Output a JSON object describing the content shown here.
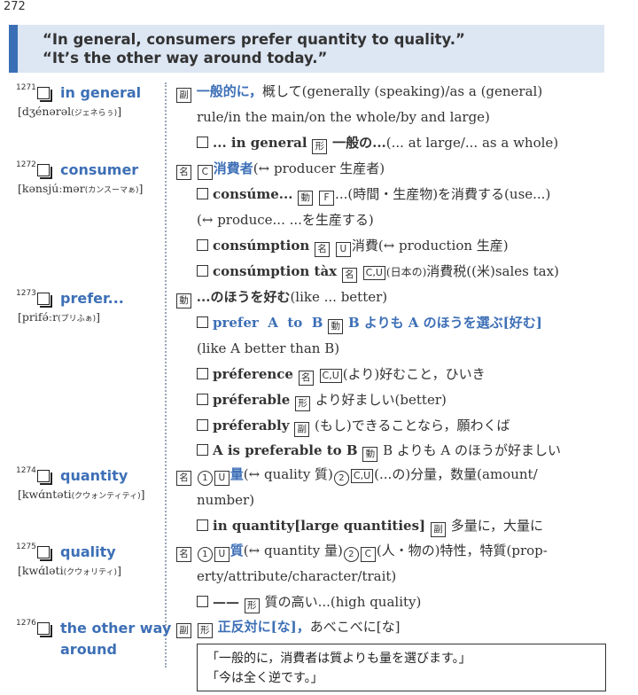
{
  "page_number": "272",
  "banner": {
    "line1": "“In general, consumers prefer quantity to quality.”",
    "line2": "“It’s the other way around today.”"
  },
  "entries": [
    {
      "num": "1271",
      "headword": "in general",
      "pron": "[dʒénərəl",
      "pron_kana": "(ジェネらぅ)",
      "pron_end": "]"
    },
    {
      "num": "1272",
      "headword": "consumer",
      "pron": "[kənsjúːmər",
      "pron_kana": "(カンスーマぁ)",
      "pron_end": "]"
    },
    {
      "num": "1273",
      "headword": "prefer...",
      "pron": "[prifə́ːr",
      "pron_kana": "(プリふぁ)",
      "pron_end": "]"
    },
    {
      "num": "1274",
      "headword": "quantity",
      "pron": "[kwɑ́ntəti",
      "pron_kana": "(クウォンティティ)",
      "pron_end": "]"
    },
    {
      "num": "1275",
      "headword": "quality",
      "pron": "[kwɑ́ləti",
      "pron_kana": "(クウォリティ)",
      "pron_end": "]"
    },
    {
      "num": "1276",
      "headword_1": "the other way",
      "headword_2": "around"
    }
  ],
  "defs": {
    "e1_l1_mark": "副",
    "e1_l1_ja": "一般的に，",
    "e1_l1_rest": "概して(generally (speaking)/as a (general)",
    "e1_l2": "rule/in the main/on the whole/by and large)",
    "e1_l3_phrase": "... in general",
    "e1_l3_mark": "形",
    "e1_l3_ja": "一般の...",
    "e1_l3_rest": "(... at large/... as a whole)",
    "e2_l1_mark": "名",
    "e2_l1_c": "C",
    "e2_l1_ja": "消費者",
    "e2_l1_rest": "(↔ producer 生産者)",
    "e2_l2_word": "consúme...",
    "e2_l2_mark": "動",
    "e2_l2_f": "F",
    "e2_l2_rest": "...(時間・生産物)を消費する(use...)",
    "e2_l3": "(↔ produce... ...を生産する)",
    "e2_l4_word": "consúmption",
    "e2_l4_mark": "名",
    "e2_l4_u": "U",
    "e2_l4_rest": "消費(↔ production 生産)",
    "e2_l5_word": "consúmption tàx",
    "e2_l5_mark": "名",
    "e2_l5_cu": "C,U",
    "e2_l5_small": "(日本の)",
    "e2_l5_rest": "消費税((米)sales tax)",
    "e3_l1_mark": "動",
    "e3_l1_ja": "...のほうを好む",
    "e3_l1_rest": "(like ... better)",
    "e3_l2_phrase": "prefer  A  to  B",
    "e3_l2_mark": "動",
    "e3_l2_ja": "B よりも A のほうを選ぶ[好む]",
    "e3_l3": "(like A better than B)",
    "e3_l4_word": "préference",
    "e3_l4_mark": "名",
    "e3_l4_cu": "C,U",
    "e3_l4_rest": "(より)好むこと，ひいき",
    "e3_l5_word": "préferable",
    "e3_l5_mark": "形",
    "e3_l5_rest": "より好ましい(better)",
    "e3_l6_word": "préferably",
    "e3_l6_mark": "副",
    "e3_l6_rest": "(もし)できることなら，願わくば",
    "e3_l7_phrase": "A is preferable to B",
    "e3_l7_mark": "動",
    "e3_l7_rest": "B よりも A のほうが好ましい",
    "e4_l1_mark": "名",
    "e4_l1_n1": "1",
    "e4_l1_u": "U",
    "e4_l1_ja": "量",
    "e4_l1_mid": "(↔ quality 質)",
    "e4_l1_n2": "2",
    "e4_l1_cu": "C,U",
    "e4_l1_rest": "(...の)分量，数量(amount/",
    "e4_l2": "number)",
    "e4_l3_phrase": "in quantity[large quantities]",
    "e4_l3_mark": "副",
    "e4_l3_rest": "多量に，大量に",
    "e5_l1_mark": "名",
    "e5_l1_n1": "1",
    "e5_l1_u": "U",
    "e5_l1_ja": "質",
    "e5_l1_mid": "(↔ quantity 量)",
    "e5_l1_n2": "2",
    "e5_l1_c": "C",
    "e5_l1_rest": "(人・物の)特性，特質(prop-",
    "e5_l2": "erty/attribute/character/trait)",
    "e5_l3_dash": "——",
    "e5_l3_mark": "形",
    "e5_l3_rest": "質の高い...(high quality)",
    "e6_l1_mark1": "副",
    "e6_l1_mark2": "形",
    "e6_l1_ja": "正反対に[な]，",
    "e6_l1_rest": "あべこべに[な]"
  },
  "translation": {
    "line1": "「一般的に，消費者は質よりも量を選びます。」",
    "line2": "「今は全く逆です。」"
  }
}
